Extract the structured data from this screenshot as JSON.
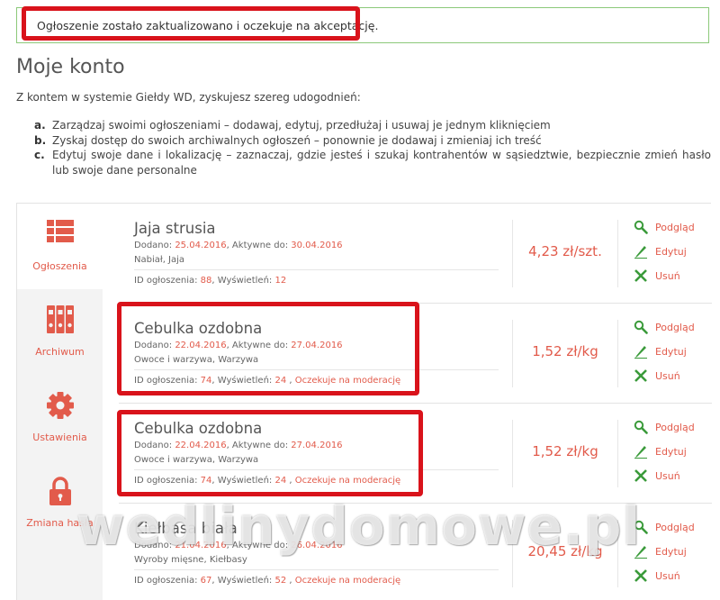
{
  "alert": {
    "message": "Ogłoszenie zostało zaktualizowano i oczekuje na akceptację."
  },
  "page_title": "Moje konto",
  "intro": "Z kontem w systemie Giełdy WD, zyskujesz szereg udogodnień:",
  "benefits": [
    {
      "marker": "a.",
      "text": "Zarządzaj swoimi ogłoszeniami – dodawaj, edytuj, przedłużaj i usuwaj je jednym kliknięciem"
    },
    {
      "marker": "b.",
      "text": "Zyskaj dostęp do swoich archiwalnych ogłoszeń – ponownie je dodawaj i zmieniaj ich treść"
    },
    {
      "marker": "c.",
      "text": "Edytuj swoje dane i lokalizację – zaznaczaj, gdzie jesteś i szukaj kontrahentów w sąsiedztwie, bezpiecznie zmień hasło lub swoje dane personalne"
    }
  ],
  "sidebar": {
    "items": [
      {
        "label": "Ogłoszenia",
        "icon": "list-icon",
        "active": true
      },
      {
        "label": "Archiwum",
        "icon": "binders-icon",
        "active": false
      },
      {
        "label": "Ustawienia",
        "icon": "gear-icon",
        "active": false
      },
      {
        "label": "Zmiana hasła",
        "icon": "lock-icon",
        "active": false
      }
    ]
  },
  "labels": {
    "added": "Dodano:",
    "active_until": ", Aktywne do:",
    "ad_id": "ID ogłoszenia:",
    "views": ", Wyświetleń:",
    "preview": "Podgląd",
    "edit": "Edytuj",
    "delete": "Usuń"
  },
  "listings": [
    {
      "title": "Jaja strusia",
      "added": "25.04.2016",
      "active_until": "30.04.2016",
      "category": "Nabiał, Jaja",
      "id": "88",
      "views": "12",
      "status": "",
      "price": "4,23 zł/szt."
    },
    {
      "title": "Cebulka ozdobna",
      "added": "22.04.2016",
      "active_until": "27.04.2016",
      "category": "Owoce i warzywa, Warzywa",
      "id": "74",
      "views": "24",
      "status": "Oczekuje na moderację",
      "price": "1,52 zł/kg"
    },
    {
      "title": "Cebulka ozdobna",
      "added": "22.04.2016",
      "active_until": "27.04.2016",
      "category": "Owoce i warzywa, Warzywa",
      "id": "74",
      "views": "24",
      "status": "Oczekuje na moderację",
      "price": "1,52 zł/kg"
    },
    {
      "title": "Kiełbasa biała",
      "added": "21.04.2016",
      "active_until": "26.04.2016",
      "category": "Wyroby mięsne, Kiełbasy",
      "id": "67",
      "views": "52",
      "status": "Oczekuje na moderację",
      "price": "20,45 zł/kg"
    }
  ],
  "watermark": "wedlinydomowe.pl",
  "colors": {
    "accent": "#e25b4b",
    "highlight": "#d9131b",
    "success_border": "#8cc97a",
    "icon_green": "#3a9a3a"
  }
}
